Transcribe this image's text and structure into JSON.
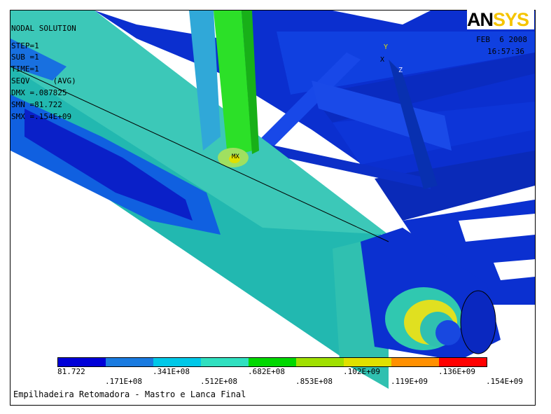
{
  "header": {
    "title": "NODAL SOLUTION",
    "step": "STEP=1",
    "sub": "SUB =1",
    "time": "TIME=1",
    "result": "SEQV     (AVG)",
    "dmx": "DMX =.087825",
    "smn": "SMN =81.722",
    "smx": "SMX =.154E+09"
  },
  "date": "FEB  6 2008",
  "time_of_day": "16:57:36",
  "logo": {
    "an": "AN",
    "sys": "SYS"
  },
  "markers": {
    "max": "MX",
    "axis_x": "X",
    "axis_y": "Y",
    "axis_z": "Z"
  },
  "legend": {
    "colors": [
      "#0000d8",
      "#1a7be0",
      "#00c8e8",
      "#30e0c0",
      "#00d800",
      "#a0e000",
      "#e0e000",
      "#ff9000",
      "#ff0000"
    ],
    "upper_labels": [
      "81.722",
      ".341E+08",
      ".682E+08",
      ".102E+09",
      ".136E+09"
    ],
    "lower_labels": [
      ".171E+08",
      ".512E+08",
      ".853E+08",
      ".119E+09",
      ".154E+09"
    ]
  },
  "caption": "Empilhadeira Retomadora - Mastro e Lanca Final"
}
